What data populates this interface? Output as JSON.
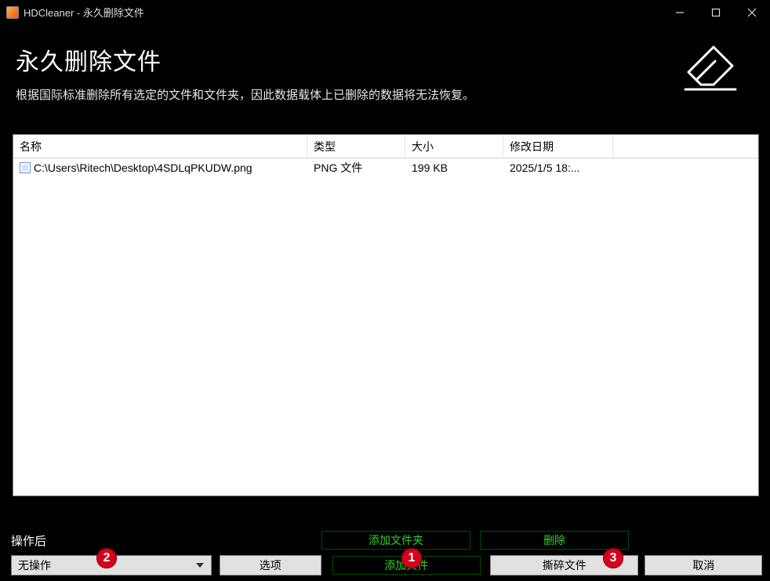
{
  "window": {
    "title": "HDCleaner - 永久删除文件"
  },
  "header": {
    "title": "永久删除文件",
    "subtitle": "根据国际标准删除所有选定的文件和文件夹，因此数据载体上已删除的数据将无法恢复。"
  },
  "table": {
    "headers": {
      "name": "名称",
      "type": "类型",
      "size": "大小",
      "date": "修改日期"
    },
    "rows": [
      {
        "name": "C:\\Users\\Ritech\\Desktop\\4SDLqPKUDW.png",
        "type": "PNG 文件",
        "size": "199 KB",
        "date": "2025/1/5 18:..."
      }
    ]
  },
  "bottom": {
    "post_op_label": "操作后",
    "select_value": "无操作",
    "options_label": "选项",
    "add_folder_label": "添加文件夹",
    "add_file_label": "添加文件",
    "delete_label": "删除",
    "shred_label": "撕碎文件",
    "cancel_label": "取消"
  },
  "badges": {
    "b1": "1",
    "b2": "2",
    "b3": "3"
  }
}
